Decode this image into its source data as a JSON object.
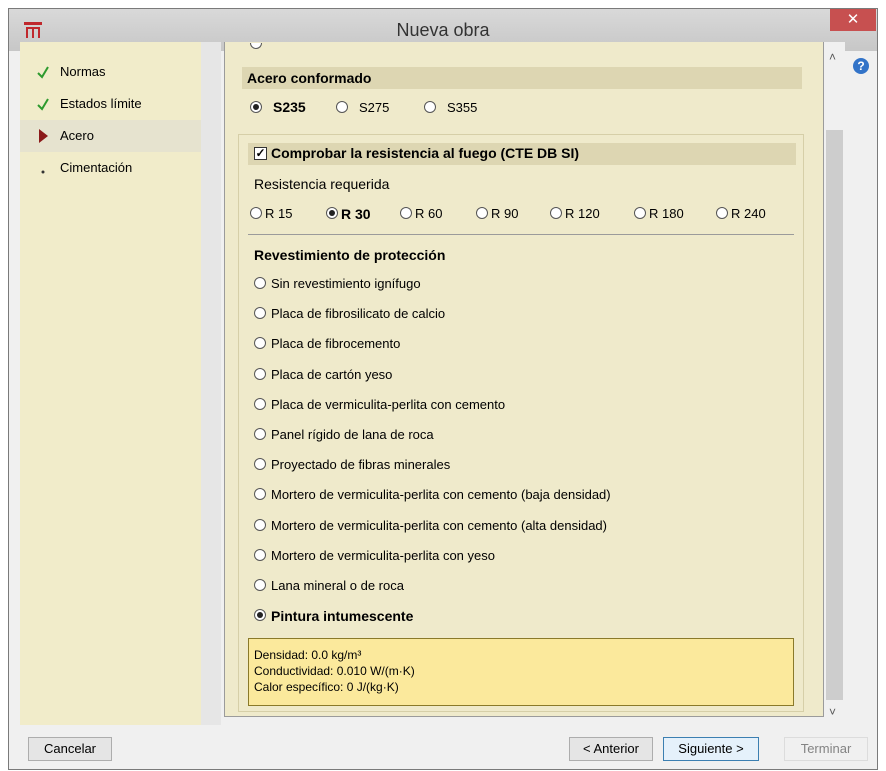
{
  "window": {
    "title": "Nueva obra",
    "close_glyph": "✕"
  },
  "sidebar": {
    "items": [
      {
        "label": "Normas",
        "icon": "check-icon"
      },
      {
        "label": "Estados límite",
        "icon": "check-icon"
      },
      {
        "label": "Acero",
        "icon": "arrow-right-icon"
      },
      {
        "label": "Cimentación",
        "icon": "bullet-icon"
      }
    ]
  },
  "acero": {
    "title": "Acero conformado",
    "options": [
      "S235",
      "S275",
      "S355"
    ],
    "selected": "S235"
  },
  "fuego": {
    "check_label": "Comprobar la resistencia al fuego (CTE DB SI)",
    "resistencia_title": "Resistencia requerida",
    "resistencia_options": [
      "R 15",
      "R 30",
      "R 60",
      "R 90",
      "R 120",
      "R 180",
      "R 240"
    ],
    "resistencia_selected": "R 30",
    "revestimiento_title": "Revestimiento de protección",
    "revestimiento_options": [
      "Sin revestimiento ignífugo",
      "Placa de fibrosilicato de calcio",
      "Placa de fibrocemento",
      "Placa de cartón yeso",
      "Placa de vermiculita-perlita con cemento",
      "Panel rígido de lana de roca",
      "Proyectado de fibras minerales",
      "Mortero de vermiculita-perlita con cemento (baja densidad)",
      "Mortero de vermiculita-perlita con cemento (alta densidad)",
      "Mortero de vermiculita-perlita con yeso",
      "Lana mineral o de roca",
      "Pintura intumescente"
    ],
    "revestimiento_selected": "Pintura intumescente",
    "info": {
      "densidad": "Densidad: 0.0 kg/m³",
      "conductividad": "Conductividad: 0.010 W/(m·K)",
      "calor": "Calor específico: 0 J/(kg·K)"
    }
  },
  "buttons": {
    "cancelar": "Cancelar",
    "anterior": "< Anterior",
    "siguiente": "Siguiente >",
    "terminar": "Terminar"
  },
  "help_glyph": "?",
  "colors": {
    "sidebar_bg": "#f1ecca",
    "panel_bg": "#efeacb",
    "info_bg": "#fbe99c",
    "close_bg": "#c75050"
  }
}
